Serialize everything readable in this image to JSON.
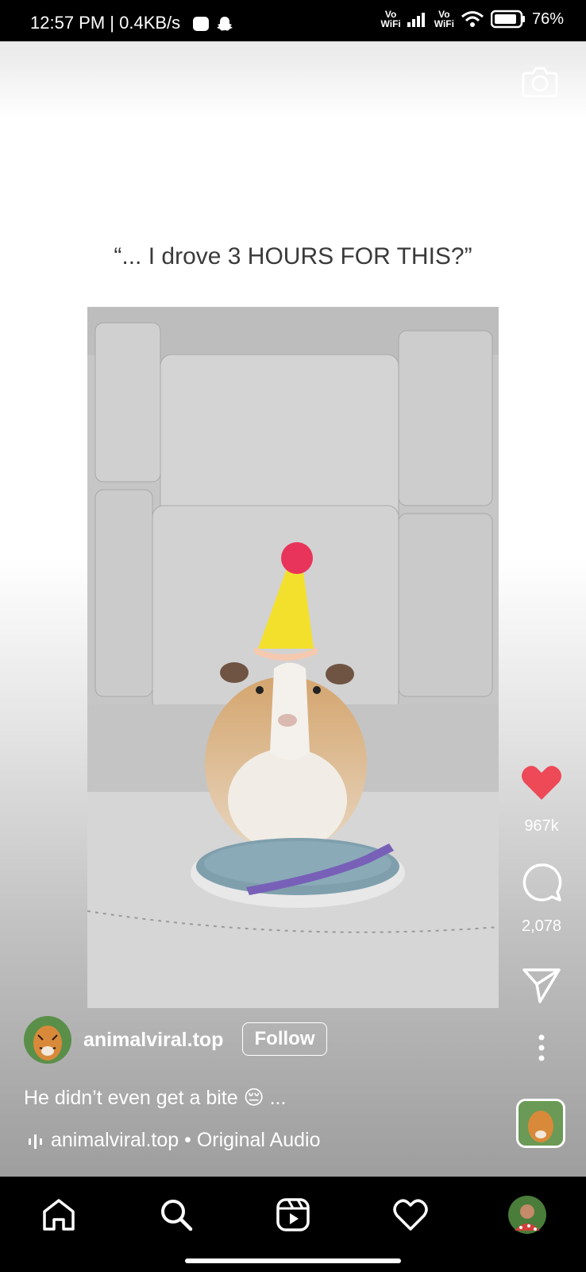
{
  "status_bar": {
    "time": "12:57 PM | 0.4KB/s",
    "network_1": "Vo\nWiFi",
    "network_2": "Vo\nWiFi",
    "battery": "76%"
  },
  "reel": {
    "caption_text": "“... I drove 3 HOURS FOR THIS?”",
    "likes": "967k",
    "comments": "2,078",
    "author": "animalviral.top",
    "follow_label": "Follow",
    "description": "He didn’t even get a bite 😔 ...",
    "audio": "animalviral.top • Original Audio"
  },
  "colors": {
    "like": "#ed4956",
    "bar_background": "#000000"
  },
  "icons": {
    "camera": "camera-icon",
    "like": "heart-filled-icon",
    "comment": "comment-icon",
    "share": "share-icon",
    "more": "more-vertical-icon",
    "audio": "audio-wave-icon"
  },
  "nav": [
    "home-icon",
    "search-icon",
    "reels-icon",
    "activity-heart-icon",
    "profile-avatar"
  ]
}
